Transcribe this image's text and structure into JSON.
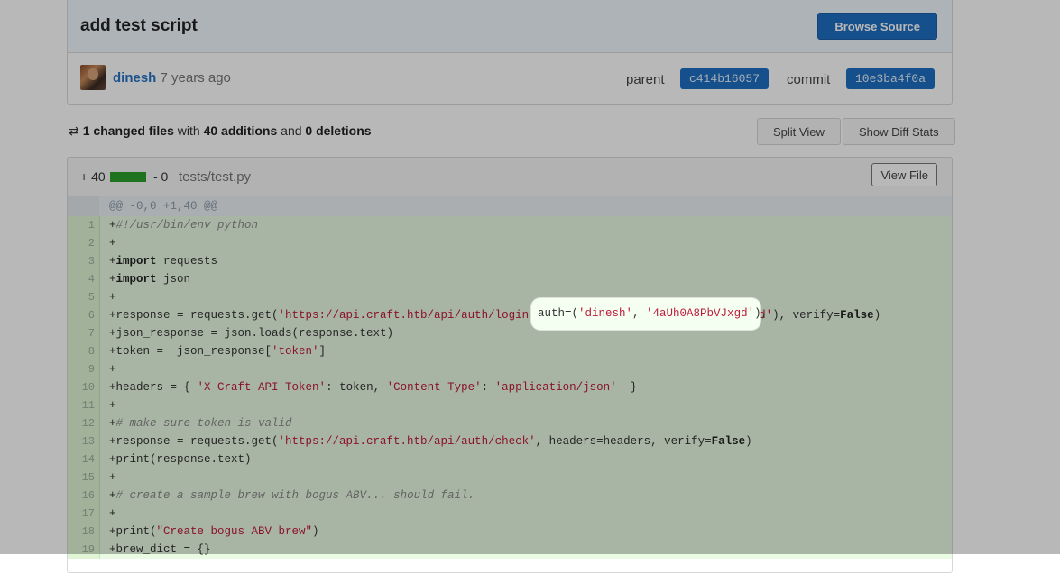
{
  "commit": {
    "title": "add test script",
    "browse_label": "Browse Source",
    "author": "dinesh",
    "time": "7 years ago",
    "parent_label": "parent",
    "parent_sha": "c414b16057",
    "commit_label": "commit",
    "commit_sha": "10e3ba4f0a"
  },
  "summary": {
    "changed": "1 changed files",
    "with": "with",
    "additions": "40 additions",
    "and": "and",
    "deletions": "0 deletions",
    "split_label": "Split View",
    "stats_label": "Show Diff Stats"
  },
  "file": {
    "adds": "+ 40",
    "dels": "- 0",
    "path": "tests/test.py",
    "view_label": "View File",
    "hunk": "@@ -0,0 +1,40 @@"
  },
  "lines": [
    {
      "n": "1",
      "segs": [
        {
          "t": "+"
        },
        {
          "t": "#!/usr/bin/env python",
          "c": "cm"
        }
      ]
    },
    {
      "n": "2",
      "segs": [
        {
          "t": "+"
        }
      ]
    },
    {
      "n": "3",
      "segs": [
        {
          "t": "+"
        },
        {
          "t": "import",
          "c": "kw"
        },
        {
          "t": " requests"
        }
      ]
    },
    {
      "n": "4",
      "segs": [
        {
          "t": "+"
        },
        {
          "t": "import",
          "c": "kw"
        },
        {
          "t": " json"
        }
      ]
    },
    {
      "n": "5",
      "segs": [
        {
          "t": "+"
        }
      ]
    },
    {
      "n": "6",
      "segs": [
        {
          "t": "+response = requests.get("
        },
        {
          "t": "'https://api.craft.htb/api/auth/login'",
          "c": "str"
        },
        {
          "t": ",  auth=("
        },
        {
          "t": "'dinesh'",
          "c": "str"
        },
        {
          "t": ", "
        },
        {
          "t": "'4aUh0A8PbVJxgd'",
          "c": "str"
        },
        {
          "t": "), verify="
        },
        {
          "t": "False",
          "c": "kw"
        },
        {
          "t": ")"
        }
      ]
    },
    {
      "n": "7",
      "segs": [
        {
          "t": "+json_response = json.loads(response.text)"
        }
      ]
    },
    {
      "n": "8",
      "segs": [
        {
          "t": "+token =  json_response["
        },
        {
          "t": "'token'",
          "c": "str"
        },
        {
          "t": "]"
        }
      ]
    },
    {
      "n": "9",
      "segs": [
        {
          "t": "+"
        }
      ]
    },
    {
      "n": "10",
      "segs": [
        {
          "t": "+headers = { "
        },
        {
          "t": "'X-Craft-API-Token'",
          "c": "str"
        },
        {
          "t": ": token, "
        },
        {
          "t": "'Content-Type'",
          "c": "str"
        },
        {
          "t": ": "
        },
        {
          "t": "'application/json'",
          "c": "str"
        },
        {
          "t": "  }"
        }
      ]
    },
    {
      "n": "11",
      "segs": [
        {
          "t": "+"
        }
      ]
    },
    {
      "n": "12",
      "segs": [
        {
          "t": "+"
        },
        {
          "t": "# make sure token is valid",
          "c": "cm"
        }
      ]
    },
    {
      "n": "13",
      "segs": [
        {
          "t": "+response = requests.get("
        },
        {
          "t": "'https://api.craft.htb/api/auth/check'",
          "c": "str"
        },
        {
          "t": ", headers=headers, verify="
        },
        {
          "t": "False",
          "c": "kw"
        },
        {
          "t": ")"
        }
      ]
    },
    {
      "n": "14",
      "segs": [
        {
          "t": "+print(response.text)"
        }
      ]
    },
    {
      "n": "15",
      "segs": [
        {
          "t": "+"
        }
      ]
    },
    {
      "n": "16",
      "segs": [
        {
          "t": "+"
        },
        {
          "t": "# create a sample brew with bogus ABV... should fail.",
          "c": "cm"
        }
      ]
    },
    {
      "n": "17",
      "segs": [
        {
          "t": "+"
        }
      ]
    },
    {
      "n": "18",
      "segs": [
        {
          "t": "+print("
        },
        {
          "t": "\"Create bogus ABV brew\"",
          "c": "str"
        },
        {
          "t": ")"
        }
      ]
    },
    {
      "n": "19",
      "segs": [
        {
          "t": "+brew_dict = {}"
        }
      ]
    }
  ],
  "spotlight": {
    "segs": [
      {
        "t": "auth=("
      },
      {
        "t": "'dinesh'",
        "c": "str"
      },
      {
        "t": ", "
      },
      {
        "t": "'4aUh0A8PbVJxgd'",
        "c": "str"
      },
      {
        "t": "),"
      }
    ]
  }
}
